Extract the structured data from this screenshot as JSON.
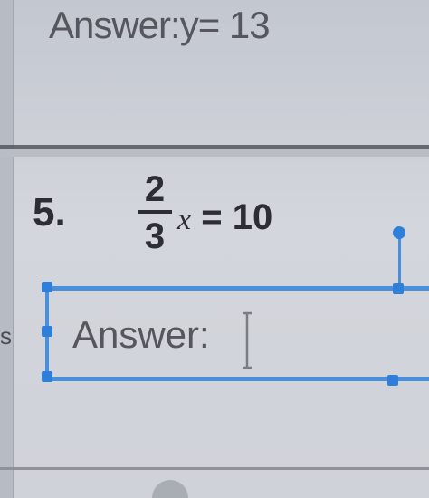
{
  "worksheet": {
    "previous_answer": "Answer:y= 13",
    "problem": {
      "number": "5.",
      "fraction_numerator": "2",
      "fraction_denominator": "3",
      "variable": "x",
      "equals_value": "= 10"
    },
    "answer_box": {
      "label": "Answer:"
    },
    "side_mark": "s"
  },
  "colors": {
    "selection": "#4a8fdc",
    "handle": "#2f7fd9",
    "divider": "#55585e"
  }
}
